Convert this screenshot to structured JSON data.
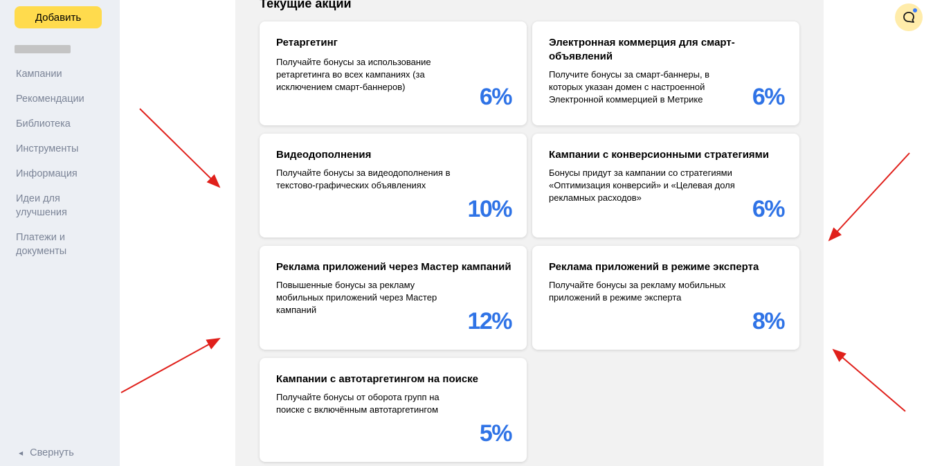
{
  "sidebar": {
    "add_label": "Добавить",
    "nav": [
      "Кампании",
      "Рекомендации",
      "Библиотека",
      "Инструменты",
      "Информация",
      "Идеи для улучшения",
      "Платежи и документы"
    ],
    "collapse_label": "Свернуть"
  },
  "main": {
    "section_title": "Текущие акции",
    "cards": [
      {
        "title": "Ретаргетинг",
        "desc": "Получайте бонусы за использование ретаргетинга во всех кампаниях (за исключением смарт-баннеров)",
        "pct": "6%"
      },
      {
        "title": "Электронная коммерция для смарт-объявлений",
        "desc": "Получите бонусы за смарт-баннеры, в которых указан домен с настроенной Электронной коммерцией в Метрике",
        "pct": "6%"
      },
      {
        "title": "Видеодополнения",
        "desc": "Получайте бонусы за видеодополнения в текстово-графических объявлениях",
        "pct": "10%"
      },
      {
        "title": "Кампании с конверсионными стратегиями",
        "desc": "Бонусы придут за кампании со стратегиями «Оптимизация конверсий» и «Целевая доля рекламных расходов»",
        "pct": "6%"
      },
      {
        "title": "Реклама приложений через Мастер кампаний",
        "desc": "Повышенные бонусы за рекламу мобильных приложений через Мастер кампаний",
        "pct": "12%"
      },
      {
        "title": "Реклама приложений в режиме эксперта",
        "desc": "Получайте бонусы за рекламу мобильных приложений в режиме эксперта",
        "pct": "8%"
      },
      {
        "title": "Кампании с автотаргетингом на поиске",
        "desc": "Получайте бонусы от оборота групп на поиске с включённым автотаргетингом",
        "pct": "5%"
      }
    ]
  },
  "colors": {
    "accent_yellow": "#ffdb4d",
    "percent_blue": "#2f73e6",
    "annotation_arrow_red": "#e0201b",
    "sidebar_bg": "#eceff4",
    "main_bg": "#f2f2f2"
  },
  "icons": {
    "chat": "chat-bubble-icon",
    "collapse": "triangle-left-icon"
  }
}
